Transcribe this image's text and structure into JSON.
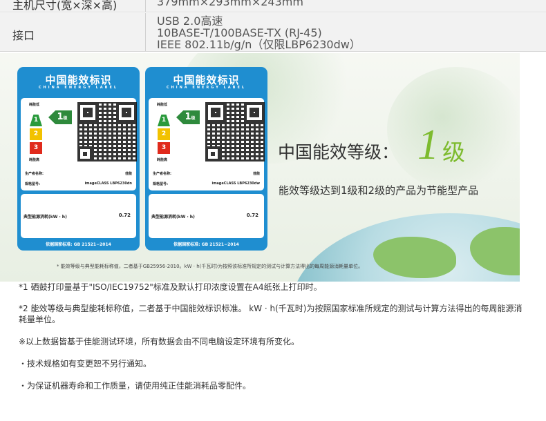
{
  "spec_table": {
    "rows": [
      {
        "key": "主机尺寸(宽×深×高)",
        "values": [
          "379mm×293mm×243mm"
        ]
      },
      {
        "key": "接口",
        "values": [
          "USB 2.0高速",
          "10BASE-T/100BASE-TX (RJ-45)",
          "IEEE 802.11b/g/n（仅限LBP6230dw）"
        ]
      }
    ]
  },
  "banner": {
    "labels": [
      {
        "title": "中国能效标识",
        "subtitle": "CHINA ENERGY LABEL",
        "low_text": "耗能低",
        "high_text": "耗能高",
        "grade": "1",
        "grade_unit": "级",
        "bars": [
          "1",
          "2",
          "3"
        ],
        "manufacturer_label": "生产者名称:",
        "manufacturer_value": "佳能",
        "model_label": "规格型号:",
        "model_value": "imageCLASS LBP6230dn",
        "consumption_label": "典型能源消耗(kW · h)",
        "consumption_value": "0.72",
        "footer": "依据国家标准: GB 21521−2014"
      },
      {
        "title": "中国能效标识",
        "subtitle": "CHINA ENERGY LABEL",
        "low_text": "耗能低",
        "high_text": "耗能高",
        "grade": "1",
        "grade_unit": "级",
        "bars": [
          "1",
          "2",
          "3"
        ],
        "manufacturer_label": "生产者名称:",
        "manufacturer_value": "佳能",
        "model_label": "规格型号:",
        "model_value": "imageCLASS LBP6230dw",
        "consumption_label": "典型能源消耗(kW · h)",
        "consumption_value": "0.72",
        "footer": "依据国家标准: GB 21521−2014"
      }
    ],
    "grade_heading": "中国能效等级：",
    "grade_number": "1",
    "grade_unit": "级",
    "grade_description": "能效等级达到1级和2级的产品为节能型产品",
    "note": "* 能效等级与典型能耗标称值，二者基于GB25956-2010。kW · h(千瓦时)为按照该标准所规定的测试与计算方法得出的每周能源消耗量单位。"
  },
  "notes": [
    "*1 硒鼓打印量基于\"ISO/IEC19752\"标准及默认打印浓度设置在A4纸张上打印时。",
    "*2 能效等级与典型能耗标称值，二者基于中国能效标识标准。 kW · h(千瓦时)为按照国家标准所规定的测试与计算方法得出的每周能源消耗量单位。",
    "※以上数据皆基于佳能测试环境，所有数据会由不同电脑设定环境有所变化。",
    "・技术规格如有变更恕不另行通知。",
    "・为保证机器寿命和工作质量，请使用纯正佳能消耗品零配件。"
  ],
  "colors": {
    "label_blue": "#1f8ed0",
    "grade_green": "#7dbb2e",
    "bar_green": "#2a9a3c",
    "bar_yellow": "#f2c200",
    "bar_red": "#e02a1c"
  }
}
